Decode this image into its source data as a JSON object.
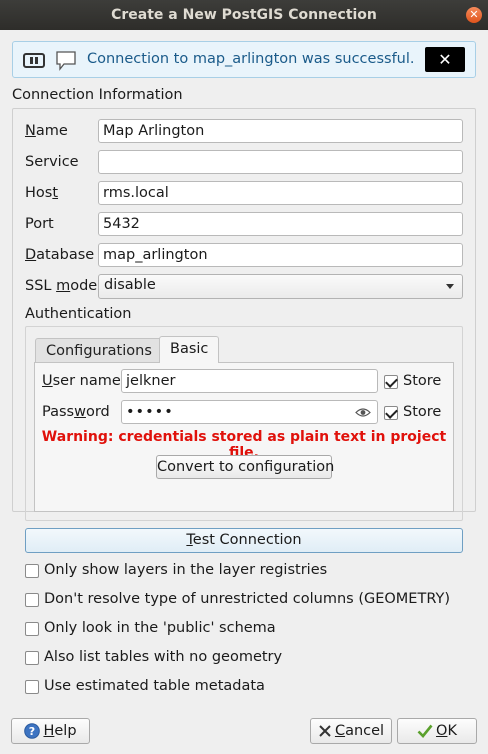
{
  "window": {
    "title": "Create a New PostGIS Connection",
    "close_glyph": "✕"
  },
  "message_bar": {
    "text": "Connection to map_arlington was successful.",
    "close_glyph": "✕"
  },
  "connection_info": {
    "title": "Connection Information",
    "name": {
      "label_underlined": "N",
      "label_rest": "ame",
      "value": "Map Arlington"
    },
    "service": {
      "label": "Service",
      "value": ""
    },
    "host": {
      "label_prefix": "Hos",
      "label_underlined": "t",
      "value": "rms.local"
    },
    "port": {
      "label": "Port",
      "value": "5432"
    },
    "database": {
      "label_underlined": "D",
      "label_rest": "atabase",
      "value": "map_arlington"
    },
    "ssl_mode": {
      "label_prefix": "SSL ",
      "label_underlined": "m",
      "label_rest": "ode",
      "value": "disable"
    }
  },
  "authentication": {
    "title": "Authentication",
    "tabs": [
      {
        "label": "Configurations"
      },
      {
        "label": "Basic"
      }
    ],
    "username": {
      "label_underlined": "U",
      "label_rest": "ser name",
      "value": "jelkner",
      "store_label": "Store",
      "store_checked": true
    },
    "password": {
      "label_prefix": "Pass",
      "label_underlined": "w",
      "label_rest": "ord",
      "value": "•••••",
      "store_label": "Store",
      "store_checked": true
    },
    "warning": "Warning: credentials stored as plain text in project file.",
    "convert_button": "Convert to configuration"
  },
  "test_button": {
    "label_underlined": "T",
    "label_rest": "est Connection"
  },
  "options": [
    {
      "label": "Only show layers in the layer registries",
      "checked": false
    },
    {
      "label": "Don't resolve type of unrestricted columns (GEOMETRY)",
      "checked": false
    },
    {
      "label": "Only look in the 'public' schema",
      "checked": false
    },
    {
      "label": "Also list tables with no geometry",
      "checked": false
    },
    {
      "label": "Use estimated table metadata",
      "checked": false
    }
  ],
  "buttons": {
    "help": {
      "label_underlined": "H",
      "label_rest": "elp",
      "icon": "help-icon"
    },
    "cancel": {
      "label_underlined": "C",
      "label_rest": "ancel",
      "icon": "cancel-icon"
    },
    "ok": {
      "label_underlined": "O",
      "label_rest": "K",
      "icon": "ok-check-icon"
    }
  },
  "colors": {
    "warning": "#e0110b",
    "info_text": "#1b5b8a",
    "title_bg": "#2e2d2a"
  }
}
